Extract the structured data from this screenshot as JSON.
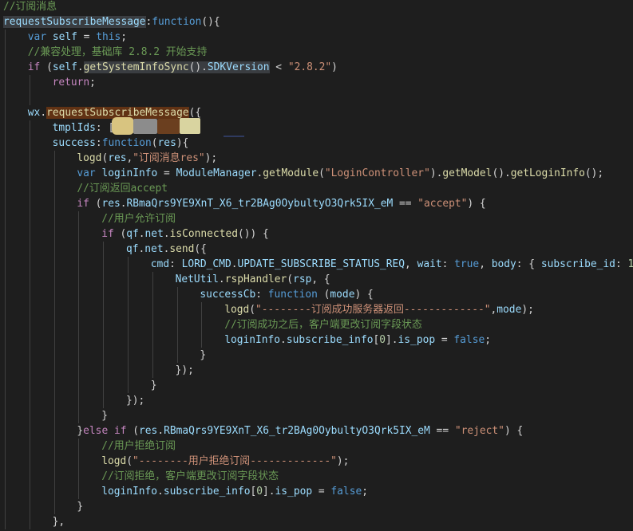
{
  "editor": {
    "theme": {
      "background": "#1e1e1e",
      "comment": "#6a9955",
      "keyword": "#569cd6",
      "function": "#dcdcaa",
      "string": "#ce9178",
      "variable": "#9cdcfe"
    },
    "lines": [
      {
        "indent": 0,
        "tokens": [
          {
            "t": "//订阅消息",
            "c": "comment"
          }
        ]
      },
      {
        "indent": 0,
        "tokens": [
          {
            "t": "requestSubscribeMessage",
            "c": "var",
            "hl": "sel"
          },
          {
            "t": ":",
            "c": "plain"
          },
          {
            "t": "function",
            "c": "keyword"
          },
          {
            "t": "(){",
            "c": "plain"
          }
        ]
      },
      {
        "indent": 1,
        "tokens": [
          {
            "t": "var ",
            "c": "keyword"
          },
          {
            "t": "self",
            "c": "var"
          },
          {
            "t": " = ",
            "c": "plain"
          },
          {
            "t": "this",
            "c": "keyword"
          },
          {
            "t": ";",
            "c": "plain"
          }
        ]
      },
      {
        "indent": 1,
        "tokens": [
          {
            "t": "//兼容处理，基础库 2.8.2 开始支持",
            "c": "comment"
          }
        ]
      },
      {
        "indent": 1,
        "tokens": [
          {
            "t": "if",
            "c": "control"
          },
          {
            "t": " (",
            "c": "plain"
          },
          {
            "t": "self",
            "c": "var"
          },
          {
            "t": ".",
            "c": "plain"
          },
          {
            "t": "getSystemInfoSync",
            "c": "func",
            "hl": "sel"
          },
          {
            "t": "().",
            "c": "plain",
            "hl": "sel"
          },
          {
            "t": "SDKVersion",
            "c": "var",
            "hl": "sel"
          },
          {
            "t": " < ",
            "c": "plain"
          },
          {
            "t": "\"2.8.2\"",
            "c": "string"
          },
          {
            "t": ")",
            "c": "plain"
          }
        ]
      },
      {
        "indent": 2,
        "tokens": [
          {
            "t": "return",
            "c": "control"
          },
          {
            "t": ";",
            "c": "plain"
          }
        ]
      },
      {
        "indent": 0,
        "tokens": []
      },
      {
        "indent": 1,
        "tokens": [
          {
            "t": "wx",
            "c": "var"
          },
          {
            "t": ".",
            "c": "plain"
          },
          {
            "t": "requestSubscribeMessage",
            "c": "func",
            "hl": "find"
          },
          {
            "t": "({",
            "c": "plain"
          }
        ]
      },
      {
        "indent": 2,
        "tokens": [
          {
            "t": "tmplIds",
            "c": "var"
          },
          {
            "t": ": [",
            "c": "plain"
          }
        ]
      },
      {
        "indent": 2,
        "tokens": [
          {
            "t": "success",
            "c": "var"
          },
          {
            "t": ":",
            "c": "plain"
          },
          {
            "t": "function",
            "c": "keyword"
          },
          {
            "t": "(",
            "c": "plain"
          },
          {
            "t": "res",
            "c": "var"
          },
          {
            "t": "){",
            "c": "plain"
          }
        ]
      },
      {
        "indent": 3,
        "tokens": [
          {
            "t": "logd",
            "c": "func"
          },
          {
            "t": "(",
            "c": "plain"
          },
          {
            "t": "res",
            "c": "var"
          },
          {
            "t": ",",
            "c": "plain"
          },
          {
            "t": "\"订阅消息res\"",
            "c": "string"
          },
          {
            "t": ");",
            "c": "plain"
          }
        ]
      },
      {
        "indent": 3,
        "tokens": [
          {
            "t": "var ",
            "c": "keyword"
          },
          {
            "t": "loginInfo",
            "c": "var"
          },
          {
            "t": " = ",
            "c": "plain"
          },
          {
            "t": "ModuleManager",
            "c": "var"
          },
          {
            "t": ".",
            "c": "plain"
          },
          {
            "t": "getModule",
            "c": "func"
          },
          {
            "t": "(",
            "c": "plain"
          },
          {
            "t": "\"LoginController\"",
            "c": "string"
          },
          {
            "t": ").",
            "c": "plain"
          },
          {
            "t": "getModel",
            "c": "func"
          },
          {
            "t": "().",
            "c": "plain"
          },
          {
            "t": "getLoginInfo",
            "c": "func"
          },
          {
            "t": "();",
            "c": "plain"
          }
        ]
      },
      {
        "indent": 3,
        "tokens": [
          {
            "t": "//订阅返回accept",
            "c": "comment"
          }
        ]
      },
      {
        "indent": 3,
        "tokens": [
          {
            "t": "if",
            "c": "control"
          },
          {
            "t": " (",
            "c": "plain"
          },
          {
            "t": "res",
            "c": "var"
          },
          {
            "t": ".",
            "c": "plain"
          },
          {
            "t": "RBmaQrs9YE9XnT_X6_tr2BAg0OybultyO3Qrk5IX_eM",
            "c": "var"
          },
          {
            "t": " == ",
            "c": "plain"
          },
          {
            "t": "\"accept\"",
            "c": "string"
          },
          {
            "t": ") {",
            "c": "plain"
          }
        ]
      },
      {
        "indent": 4,
        "tokens": [
          {
            "t": "//用户允许订阅",
            "c": "comment"
          }
        ]
      },
      {
        "indent": 4,
        "tokens": [
          {
            "t": "if",
            "c": "control"
          },
          {
            "t": " (",
            "c": "plain"
          },
          {
            "t": "qf",
            "c": "var"
          },
          {
            "t": ".",
            "c": "plain"
          },
          {
            "t": "net",
            "c": "var"
          },
          {
            "t": ".",
            "c": "plain"
          },
          {
            "t": "isConnected",
            "c": "func"
          },
          {
            "t": "()) {",
            "c": "plain"
          }
        ]
      },
      {
        "indent": 5,
        "tokens": [
          {
            "t": "qf",
            "c": "var"
          },
          {
            "t": ".",
            "c": "plain"
          },
          {
            "t": "net",
            "c": "var"
          },
          {
            "t": ".",
            "c": "plain"
          },
          {
            "t": "send",
            "c": "func"
          },
          {
            "t": "({",
            "c": "plain"
          }
        ]
      },
      {
        "indent": 6,
        "tokens": [
          {
            "t": "cmd",
            "c": "var"
          },
          {
            "t": ": ",
            "c": "plain"
          },
          {
            "t": "LORD_CMD",
            "c": "var"
          },
          {
            "t": ".",
            "c": "plain"
          },
          {
            "t": "UPDATE_SUBSCRIBE_STATUS_REQ",
            "c": "var"
          },
          {
            "t": ", ",
            "c": "plain"
          },
          {
            "t": "wait",
            "c": "var"
          },
          {
            "t": ": ",
            "c": "plain"
          },
          {
            "t": "true",
            "c": "keyword"
          },
          {
            "t": ", ",
            "c": "plain"
          },
          {
            "t": "body",
            "c": "var"
          },
          {
            "t": ": { ",
            "c": "plain"
          },
          {
            "t": "subscribe_id",
            "c": "var"
          },
          {
            "t": ": ",
            "c": "plain"
          },
          {
            "t": "1",
            "c": "number"
          }
        ]
      },
      {
        "indent": 7,
        "tokens": [
          {
            "t": "NetUtil",
            "c": "var"
          },
          {
            "t": ".",
            "c": "plain"
          },
          {
            "t": "rspHandler",
            "c": "func"
          },
          {
            "t": "(",
            "c": "plain"
          },
          {
            "t": "rsp",
            "c": "var"
          },
          {
            "t": ", {",
            "c": "plain"
          }
        ]
      },
      {
        "indent": 8,
        "tokens": [
          {
            "t": "successCb",
            "c": "var"
          },
          {
            "t": ": ",
            "c": "plain"
          },
          {
            "t": "function",
            "c": "keyword"
          },
          {
            "t": " (",
            "c": "plain"
          },
          {
            "t": "mode",
            "c": "var"
          },
          {
            "t": ") {",
            "c": "plain"
          }
        ]
      },
      {
        "indent": 9,
        "tokens": [
          {
            "t": "logd",
            "c": "func"
          },
          {
            "t": "(",
            "c": "plain"
          },
          {
            "t": "\"--------订阅成功服务器返回-------------\"",
            "c": "string"
          },
          {
            "t": ",",
            "c": "plain"
          },
          {
            "t": "mode",
            "c": "var"
          },
          {
            "t": ");",
            "c": "plain"
          }
        ]
      },
      {
        "indent": 9,
        "tokens": [
          {
            "t": "//订阅成功之后，客户端更改订阅字段状态",
            "c": "comment"
          }
        ]
      },
      {
        "indent": 9,
        "tokens": [
          {
            "t": "loginInfo",
            "c": "var"
          },
          {
            "t": ".",
            "c": "plain"
          },
          {
            "t": "subscribe_info",
            "c": "var"
          },
          {
            "t": "[",
            "c": "plain"
          },
          {
            "t": "0",
            "c": "number"
          },
          {
            "t": "].",
            "c": "plain"
          },
          {
            "t": "is_pop",
            "c": "var"
          },
          {
            "t": " = ",
            "c": "plain"
          },
          {
            "t": "false",
            "c": "keyword"
          },
          {
            "t": ";",
            "c": "plain"
          }
        ]
      },
      {
        "indent": 8,
        "tokens": [
          {
            "t": "}",
            "c": "plain"
          }
        ]
      },
      {
        "indent": 7,
        "tokens": [
          {
            "t": "});",
            "c": "plain"
          }
        ]
      },
      {
        "indent": 6,
        "tokens": [
          {
            "t": "}",
            "c": "plain"
          }
        ]
      },
      {
        "indent": 5,
        "tokens": [
          {
            "t": "});",
            "c": "plain"
          }
        ]
      },
      {
        "indent": 4,
        "tokens": [
          {
            "t": "}",
            "c": "plain"
          }
        ]
      },
      {
        "indent": 3,
        "tokens": [
          {
            "t": "}",
            "c": "plain"
          },
          {
            "t": "else if",
            "c": "control"
          },
          {
            "t": " (",
            "c": "plain"
          },
          {
            "t": "res",
            "c": "var"
          },
          {
            "t": ".",
            "c": "plain"
          },
          {
            "t": "RBmaQrs9YE9XnT_X6_tr2BAg0OybultyO3Qrk5IX_eM",
            "c": "var"
          },
          {
            "t": " == ",
            "c": "plain"
          },
          {
            "t": "\"reject\"",
            "c": "string"
          },
          {
            "t": ") {",
            "c": "plain"
          }
        ]
      },
      {
        "indent": 4,
        "tokens": [
          {
            "t": "//用户拒绝订阅",
            "c": "comment"
          }
        ]
      },
      {
        "indent": 4,
        "tokens": [
          {
            "t": "logd",
            "c": "func"
          },
          {
            "t": "(",
            "c": "plain"
          },
          {
            "t": "\"--------用户拒绝订阅-------------\"",
            "c": "string"
          },
          {
            "t": ");",
            "c": "plain"
          }
        ]
      },
      {
        "indent": 4,
        "tokens": [
          {
            "t": "//订阅拒绝，客户端更改订阅字段状态",
            "c": "comment"
          }
        ]
      },
      {
        "indent": 4,
        "tokens": [
          {
            "t": "loginInfo",
            "c": "var"
          },
          {
            "t": ".",
            "c": "plain"
          },
          {
            "t": "subscribe_info",
            "c": "var"
          },
          {
            "t": "[",
            "c": "plain"
          },
          {
            "t": "0",
            "c": "number"
          },
          {
            "t": "].",
            "c": "plain"
          },
          {
            "t": "is_pop",
            "c": "var"
          },
          {
            "t": " = ",
            "c": "plain"
          },
          {
            "t": "false",
            "c": "keyword"
          },
          {
            "t": ";",
            "c": "plain"
          }
        ]
      },
      {
        "indent": 3,
        "tokens": [
          {
            "t": "}",
            "c": "plain"
          }
        ]
      },
      {
        "indent": 2,
        "tokens": [
          {
            "t": "},",
            "c": "plain"
          }
        ]
      }
    ]
  }
}
